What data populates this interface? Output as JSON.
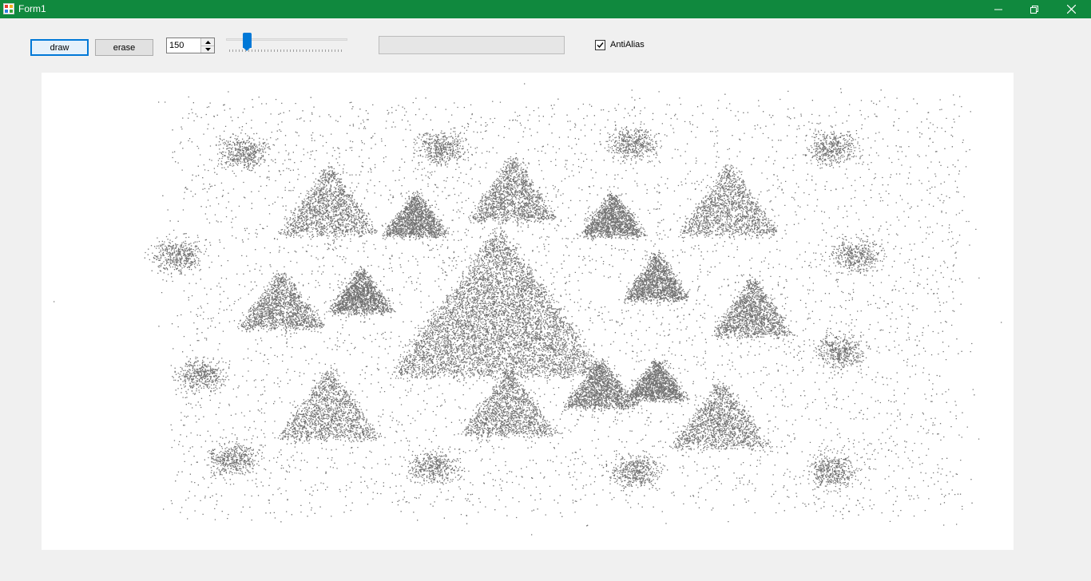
{
  "window": {
    "title": "Form1",
    "titlebar_color": "#10893e",
    "icons": [
      "form-icon",
      "minimize-icon",
      "restore-icon",
      "close-icon"
    ]
  },
  "toolbar": {
    "draw_label": "draw",
    "erase_label": "erase",
    "point_count": "150",
    "slider_value_fraction": 0.15,
    "progress_fraction": 0,
    "antialias_label": "AntiAlias",
    "antialias_checked": true
  },
  "canvas": {
    "background": "#ffffff",
    "content": "Sierpinski-like scattered dot triangles"
  }
}
